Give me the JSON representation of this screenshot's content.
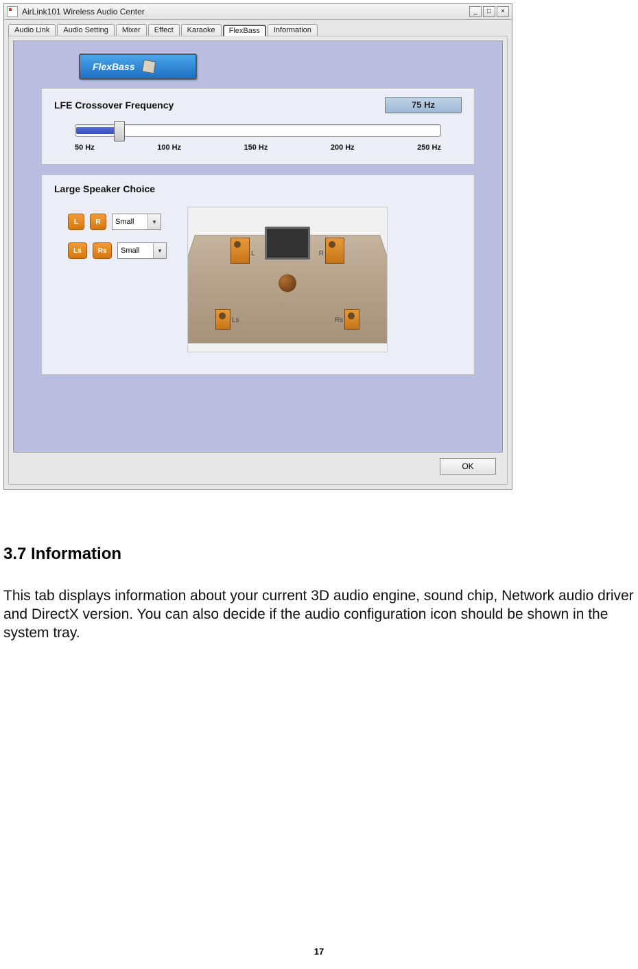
{
  "window": {
    "title": "AirLink101 Wireless Audio Center",
    "buttons": {
      "min": "_",
      "max": "□",
      "close": "×"
    },
    "tabs": [
      "Audio Link",
      "Audio Setting",
      "Mixer",
      "Effect",
      "Karaoke",
      "FlexBass",
      "Information"
    ],
    "active_tab": 5,
    "ok": "OK"
  },
  "flexbass": {
    "banner": "FlexBass",
    "lfe": {
      "title": "LFE Crossover Frequency",
      "value_display": "75 Hz",
      "ticks": [
        "50 Hz",
        "100 Hz",
        "150 Hz",
        "200 Hz",
        "250 Hz"
      ]
    },
    "speaker": {
      "title": "Large Speaker Choice",
      "rows": [
        {
          "chips": [
            "L",
            "R"
          ],
          "value": "Small"
        },
        {
          "chips": [
            "Ls",
            "Rs"
          ],
          "value": "Small"
        }
      ],
      "room_labels": {
        "l": "L",
        "r": "R",
        "ls": "Ls",
        "rs": "Rs"
      }
    }
  },
  "doc": {
    "heading": "3.7 Information",
    "paragraph": "This tab displays information about your current 3D audio engine, sound chip, Network audio driver and DirectX version. You can also decide if the audio configuration icon should be shown in the system tray.",
    "page_number": "17"
  }
}
